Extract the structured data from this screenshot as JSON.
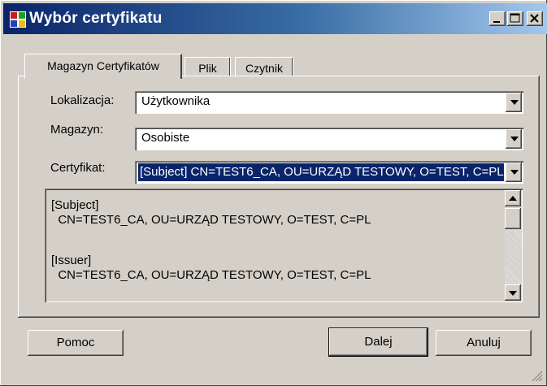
{
  "window": {
    "title": "Wybór certyfikatu"
  },
  "tabs": [
    {
      "label": "Magazyn Certyfikatów",
      "selected": true
    },
    {
      "label": "Plik",
      "selected": false
    },
    {
      "label": "Czytnik",
      "selected": false
    }
  ],
  "form": {
    "location_label": "Lokalizacja:",
    "location_value": "Użytkownika",
    "store_label": "Magazyn:",
    "store_value": "Osobiste",
    "certificate_label": "Certyfikat:",
    "certificate_value": "[Subject]  CN=TEST6_CA, OU=URZĄD TESTOWY, O=TEST, C=PL"
  },
  "details": {
    "lines": [
      "[Subject]",
      "  CN=TEST6_CA, OU=URZĄD TESTOWY, O=TEST, C=PL",
      "",
      "[Issuer]",
      "  CN=TEST6_CA, OU=URZĄD TESTOWY, O=TEST, C=PL"
    ]
  },
  "buttons": {
    "help": "Pomoc",
    "next": "Dalej",
    "cancel": "Anuluj"
  },
  "colors": {
    "title_bar_start": "#0a246a",
    "title_bar_end": "#a6caf0",
    "selection": "#0a246a",
    "face": "#d4d0c8"
  }
}
